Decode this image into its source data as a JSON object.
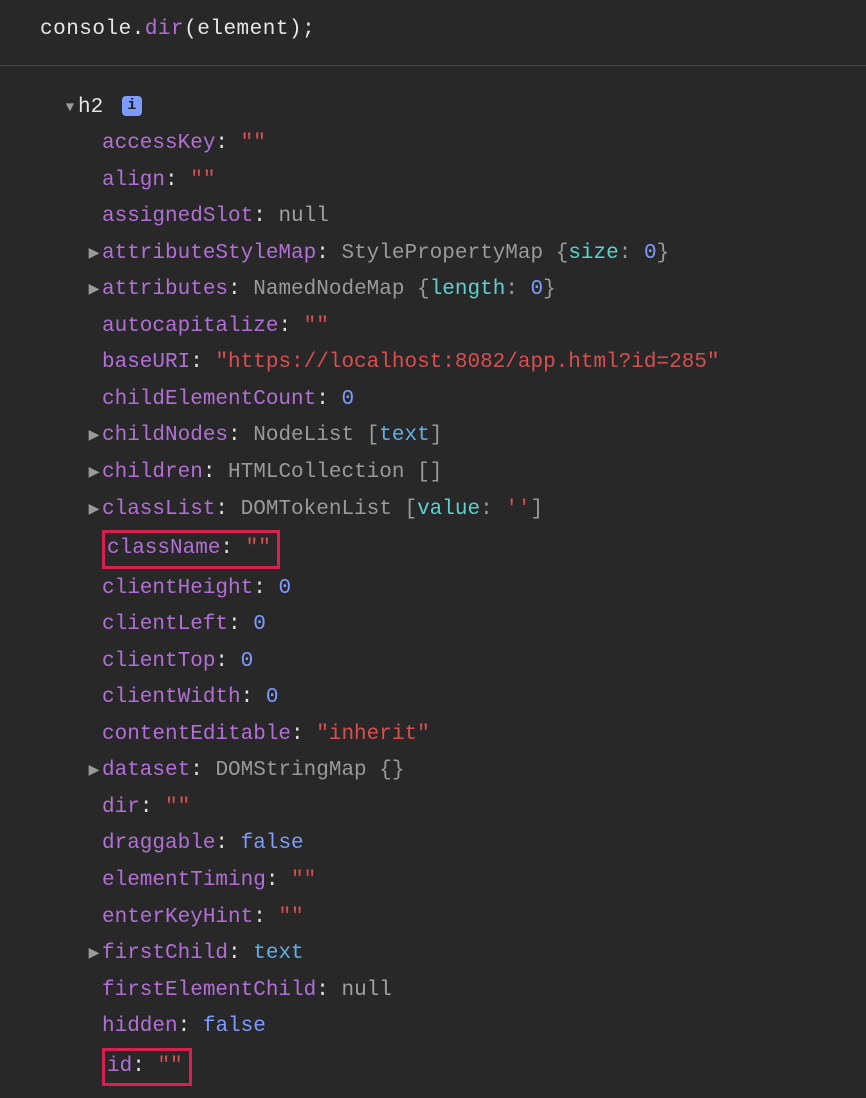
{
  "header": {
    "obj": "console",
    "fn": "dir",
    "arg": "element"
  },
  "root": {
    "tag": "h2",
    "info": "i"
  },
  "props": {
    "accessKey": {
      "value": "\"\"",
      "cls": "str"
    },
    "align": {
      "value": "\"\"",
      "cls": "str"
    },
    "assignedSlot": {
      "value": "null",
      "cls": "nul"
    },
    "attributeStyleMap": {
      "expand": true,
      "summary": {
        "type": "StylePropertyMap",
        "brace_open": "{",
        "k": "size",
        "sep": ": ",
        "v": "0",
        "brace_close": "}"
      }
    },
    "attributes": {
      "expand": true,
      "summary": {
        "type": "NamedNodeMap",
        "brace_open": "{",
        "k": "length",
        "sep": ": ",
        "v": "0",
        "brace_close": "}"
      }
    },
    "autocapitalize": {
      "value": "\"\"",
      "cls": "str"
    },
    "baseURI": {
      "value": "\"https://localhost:8082/app.html?id=285\"",
      "cls": "str"
    },
    "childElementCount": {
      "value": "0",
      "cls": "num"
    },
    "childNodes": {
      "expand": true,
      "summary": {
        "type": "NodeList",
        "brace_open": "[",
        "linkv": "text",
        "brace_close": "]"
      }
    },
    "children": {
      "expand": true,
      "summary": {
        "type": "HTMLCollection",
        "brace_open": "[",
        "brace_close": "]"
      }
    },
    "classList": {
      "expand": true,
      "summary": {
        "type": "DOMTokenList",
        "brace_open": "[",
        "k": "value",
        "sep": ": ",
        "strv": "''",
        "brace_close": "]"
      }
    },
    "className": {
      "value": "\"\"",
      "cls": "str",
      "highlight": true
    },
    "clientHeight": {
      "value": "0",
      "cls": "num"
    },
    "clientLeft": {
      "value": "0",
      "cls": "num"
    },
    "clientTop": {
      "value": "0",
      "cls": "num"
    },
    "clientWidth": {
      "value": "0",
      "cls": "num"
    },
    "contentEditable": {
      "value": "\"inherit\"",
      "cls": "str"
    },
    "dataset": {
      "expand": true,
      "summary": {
        "type": "DOMStringMap",
        "brace_open": "{",
        "brace_close": "}"
      }
    },
    "dir": {
      "value": "\"\"",
      "cls": "str"
    },
    "draggable": {
      "value": "false",
      "cls": "kw"
    },
    "elementTiming": {
      "value": "\"\"",
      "cls": "str"
    },
    "enterKeyHint": {
      "value": "\"\"",
      "cls": "str"
    },
    "firstChild": {
      "expand": true,
      "summary": {
        "linkv": "text"
      }
    },
    "firstElementChild": {
      "value": "null",
      "cls": "nul"
    },
    "hidden": {
      "value": "false",
      "cls": "kw"
    },
    "id": {
      "value": "\"\"",
      "cls": "str",
      "highlight": true
    }
  },
  "order": [
    "accessKey",
    "align",
    "assignedSlot",
    "attributeStyleMap",
    "attributes",
    "autocapitalize",
    "baseURI",
    "childElementCount",
    "childNodes",
    "children",
    "classList",
    "className",
    "clientHeight",
    "clientLeft",
    "clientTop",
    "clientWidth",
    "contentEditable",
    "dataset",
    "dir",
    "draggable",
    "elementTiming",
    "enterKeyHint",
    "firstChild",
    "firstElementChild",
    "hidden",
    "id"
  ]
}
